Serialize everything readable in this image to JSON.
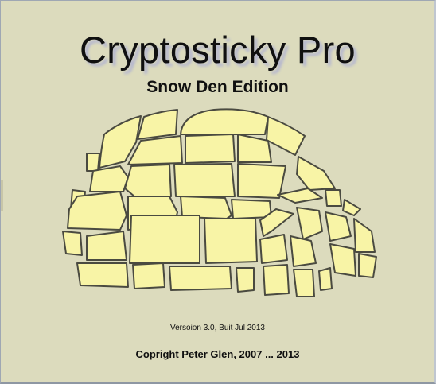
{
  "splash": {
    "title": "Cryptosticky Pro",
    "subtitle": "Snow Den Edition",
    "version": "Versoion 3.0, Buit Jul 2013",
    "copyright": "Copright Peter Glen, 2007 ... 2013"
  },
  "colors": {
    "background": "#dcdbbd",
    "block_fill": "#f8f4a6",
    "block_outline": "#4a4a40",
    "title_shadow": "#b5b7cf"
  },
  "icons": {
    "illustration": "igloo"
  }
}
